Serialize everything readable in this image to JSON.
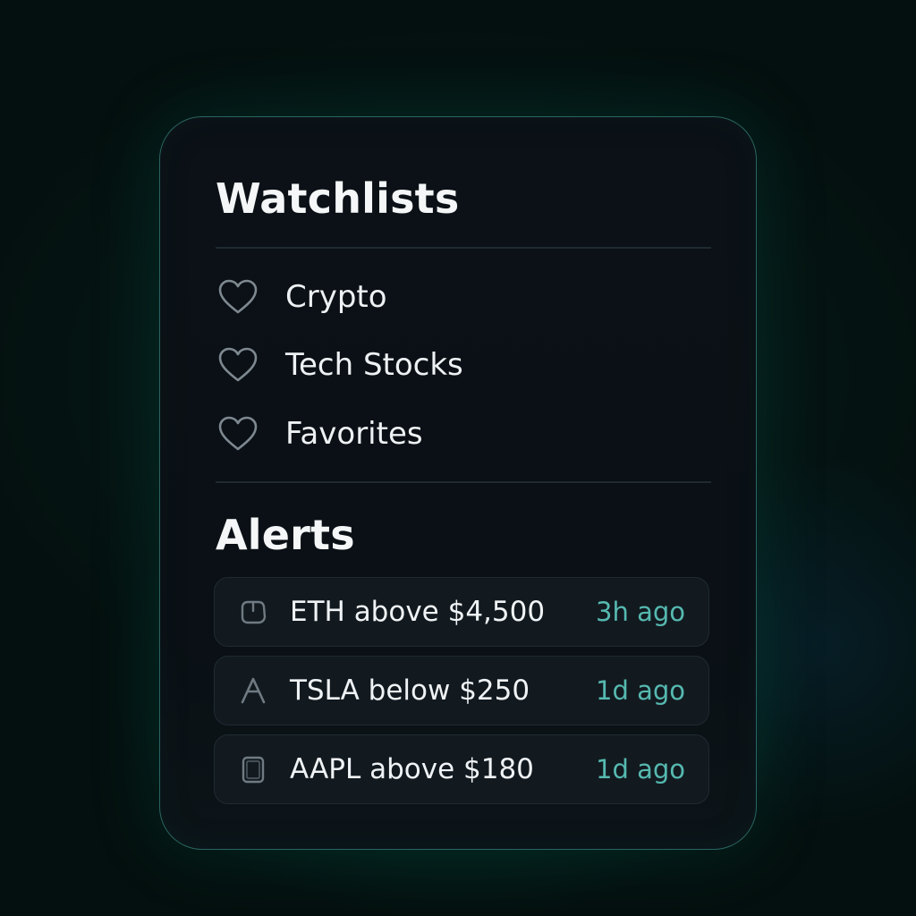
{
  "watchlists": {
    "title": "Watchlists",
    "items": [
      {
        "label": "Crypto",
        "icon": "heart-icon"
      },
      {
        "label": "Tech Stocks",
        "icon": "heart-icon"
      },
      {
        "label": "Favorites",
        "icon": "heart-icon"
      }
    ]
  },
  "alerts": {
    "title": "Alerts",
    "items": [
      {
        "text": "ETH above $4,500",
        "time": "3h ago",
        "icon": "power-icon"
      },
      {
        "text": "TSLA below $250",
        "time": "1d ago",
        "icon": "tesla-icon"
      },
      {
        "text": "AAPL above $180",
        "time": "1d ago",
        "icon": "tablet-icon"
      }
    ]
  },
  "colors": {
    "accent": "#56b9b0",
    "card_border": "#46aaa0",
    "background": "#04100f",
    "card": "#0b1116",
    "alert_row": "#121a20"
  }
}
